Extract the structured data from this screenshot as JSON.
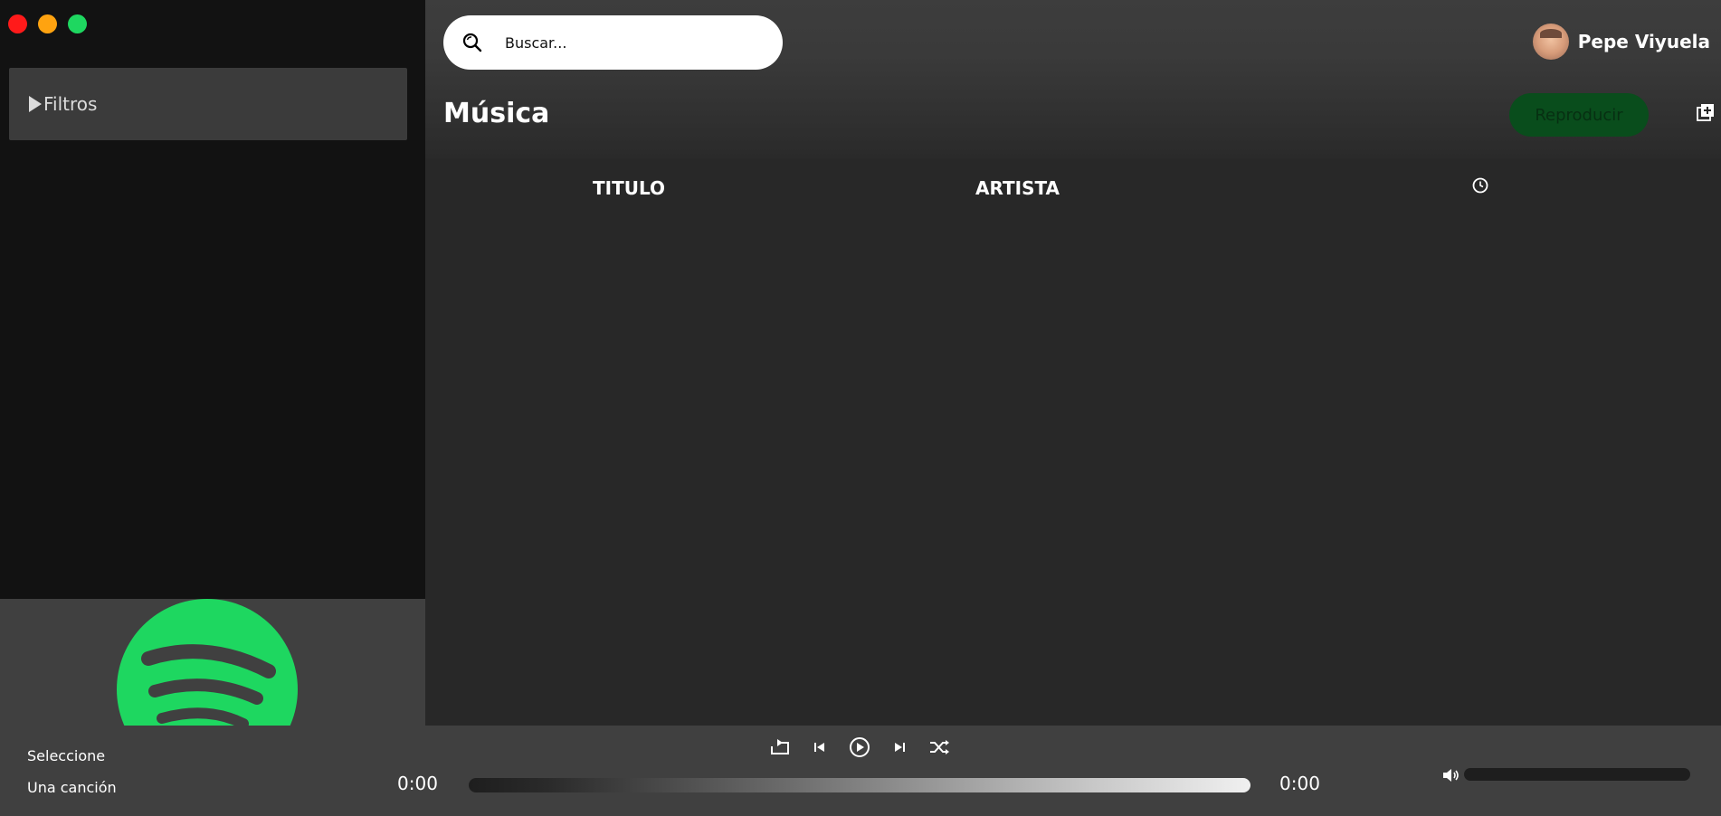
{
  "sidebar": {
    "filters_label": "Filtros"
  },
  "header": {
    "search_placeholder": "Buscar...",
    "user_name": "Pepe Viyuela",
    "page_title": "Música",
    "play_label": "Reproducir"
  },
  "table": {
    "columns": [
      "TITULO",
      "ARTISTA"
    ],
    "duration_icon": "clock-icon"
  },
  "player": {
    "song_line1": "Seleccione",
    "song_line2": "Una canción",
    "time_current": "0:00",
    "time_total": "0:00"
  },
  "colors": {
    "accent": "#1ed760",
    "sidebar_bg": "#121212",
    "main_bg": "#282828",
    "player_bg": "#404040"
  }
}
